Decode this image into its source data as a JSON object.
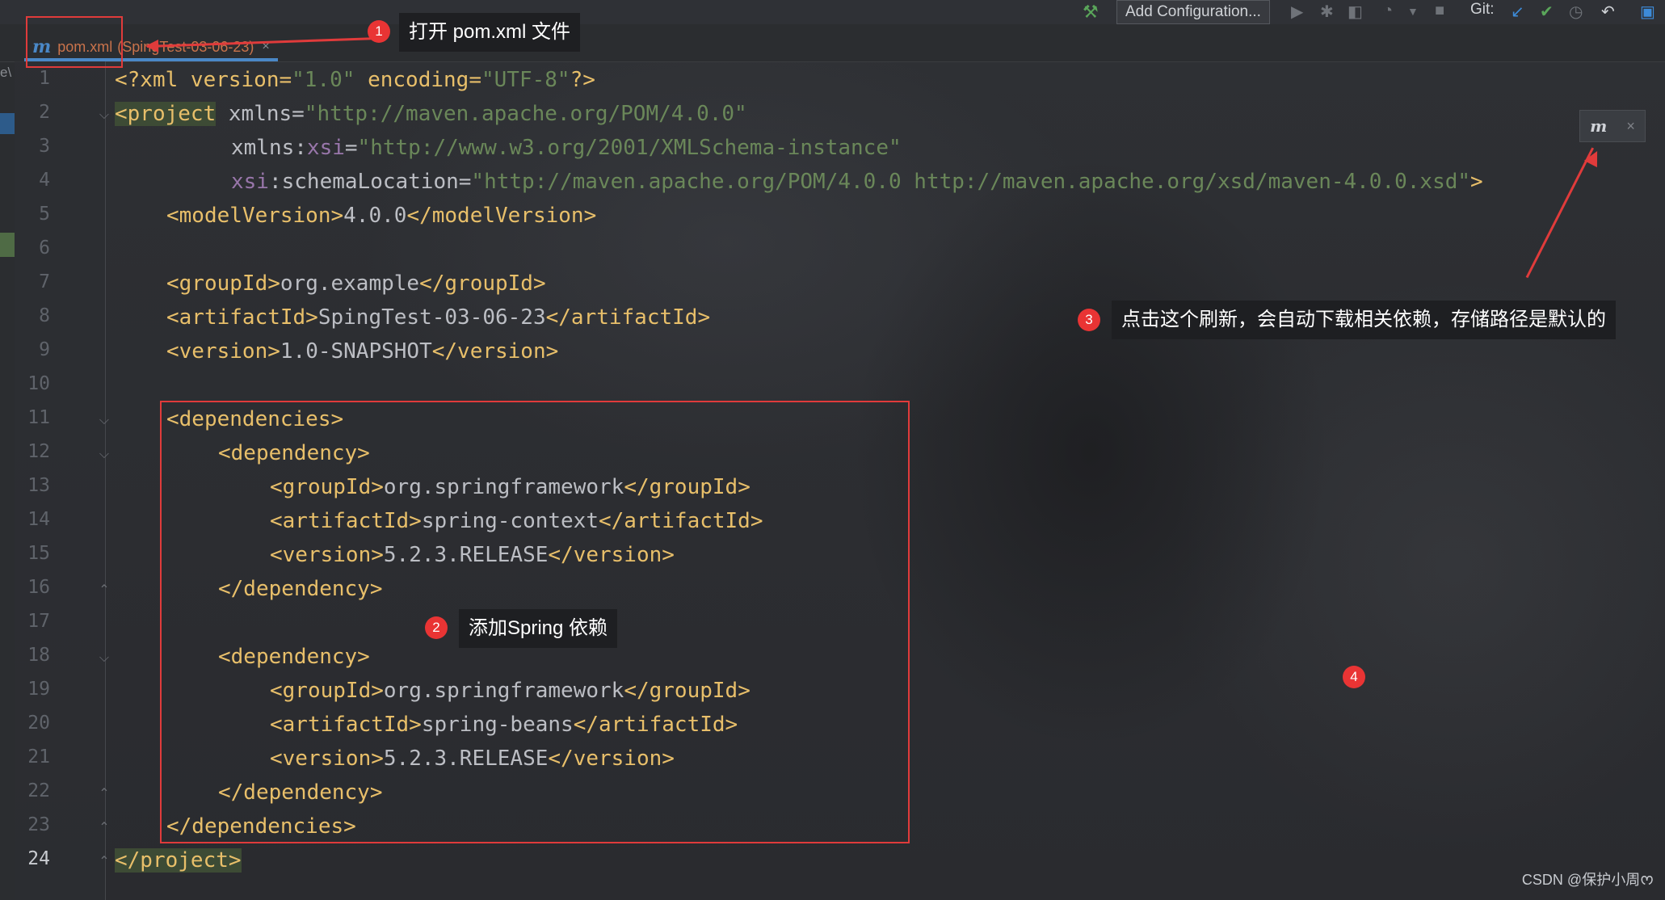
{
  "toolbar": {
    "add_configuration": "Add Configuration...",
    "git_label": "Git:",
    "icons": [
      "build-hammer-icon",
      "run-icon",
      "debug-icon",
      "coverage-icon",
      "profile-icon",
      "dropdown-icon",
      "stop-icon",
      "vcs-update-icon",
      "vcs-commit-icon",
      "history-icon",
      "rollback-icon",
      "project-structure-icon"
    ]
  },
  "tab": {
    "file": "pom.xml",
    "project": "(SpingTest-03-06-23)",
    "close": "×"
  },
  "left_stub": "e\\",
  "gutter": {
    "line_numbers": [
      "1",
      "2",
      "3",
      "4",
      "5",
      "6",
      "7",
      "8",
      "9",
      "10",
      "11",
      "12",
      "13",
      "14",
      "15",
      "16",
      "17",
      "18",
      "19",
      "20",
      "21",
      "22",
      "23",
      "24"
    ],
    "current_line": "24"
  },
  "code": {
    "l1_a": "<?xml version=",
    "l1_b": "\"1.0\"",
    "l1_c": " encoding=",
    "l1_d": "\"UTF-8\"",
    "l1_e": "?>",
    "l2_a": "<project",
    "l2_b": " xmlns=",
    "l2_c": "\"http://maven.apache.org/POM/4.0.0\"",
    "l3_a": "xmlns:",
    "l3_b": "xsi",
    "l3_c": "=",
    "l3_d": "\"http://www.w3.org/2001/XMLSchema-instance\"",
    "l4_a": "xsi",
    "l4_b": ":schemaLocation=",
    "l4_c": "\"http://maven.apache.org/POM/4.0.0 http://maven.apache.org/xsd/maven-4.0.0.xsd\"",
    "l4_d": ">",
    "l5_a": "<modelVersion>",
    "l5_b": "4.0.0",
    "l5_c": "</modelVersion>",
    "l7_a": "<groupId>",
    "l7_b": "org.example",
    "l7_c": "</groupId>",
    "l8_a": "<artifactId>",
    "l8_b": "SpingTest-03-06-23",
    "l8_c": "</artifactId>",
    "l9_a": "<version>",
    "l9_b": "1.0-SNAPSHOT",
    "l9_c": "</version>",
    "l11": "<dependencies>",
    "l12": "<dependency>",
    "l13_a": "<groupId>",
    "l13_b": "org.springframework",
    "l13_c": "</groupId>",
    "l14_a": "<artifactId>",
    "l14_b": "spring-context",
    "l14_c": "</artifactId>",
    "l15_a": "<version>",
    "l15_b": "5.2.3.RELEASE",
    "l15_c": "</version>",
    "l16": "</dependency>",
    "l18": "<dependency>",
    "l19_a": "<groupId>",
    "l19_b": "org.springframework",
    "l19_c": "</groupId>",
    "l20_a": "<artifactId>",
    "l20_b": "spring-beans",
    "l20_c": "</artifactId>",
    "l21_a": "<version>",
    "l21_b": "5.2.3.RELEASE",
    "l21_c": "</version>",
    "l22": "</dependency>",
    "l23": "</dependencies>",
    "l24": "</project>"
  },
  "annotations": {
    "step1_badge": "1",
    "step1_text": "打开 pom.xml 文件",
    "step2_badge": "2",
    "step2_text": "添加Spring 依赖",
    "step3_badge": "3",
    "step3_text": "点击这个刷新，会自动下载相关依赖，存储路径是默认的",
    "step4_badge": "4",
    "accent_color": "#e03b3b"
  },
  "maven_popup": {
    "icon": "m",
    "close": "×"
  },
  "watermark": "CSDN @保护小周ᰔ"
}
